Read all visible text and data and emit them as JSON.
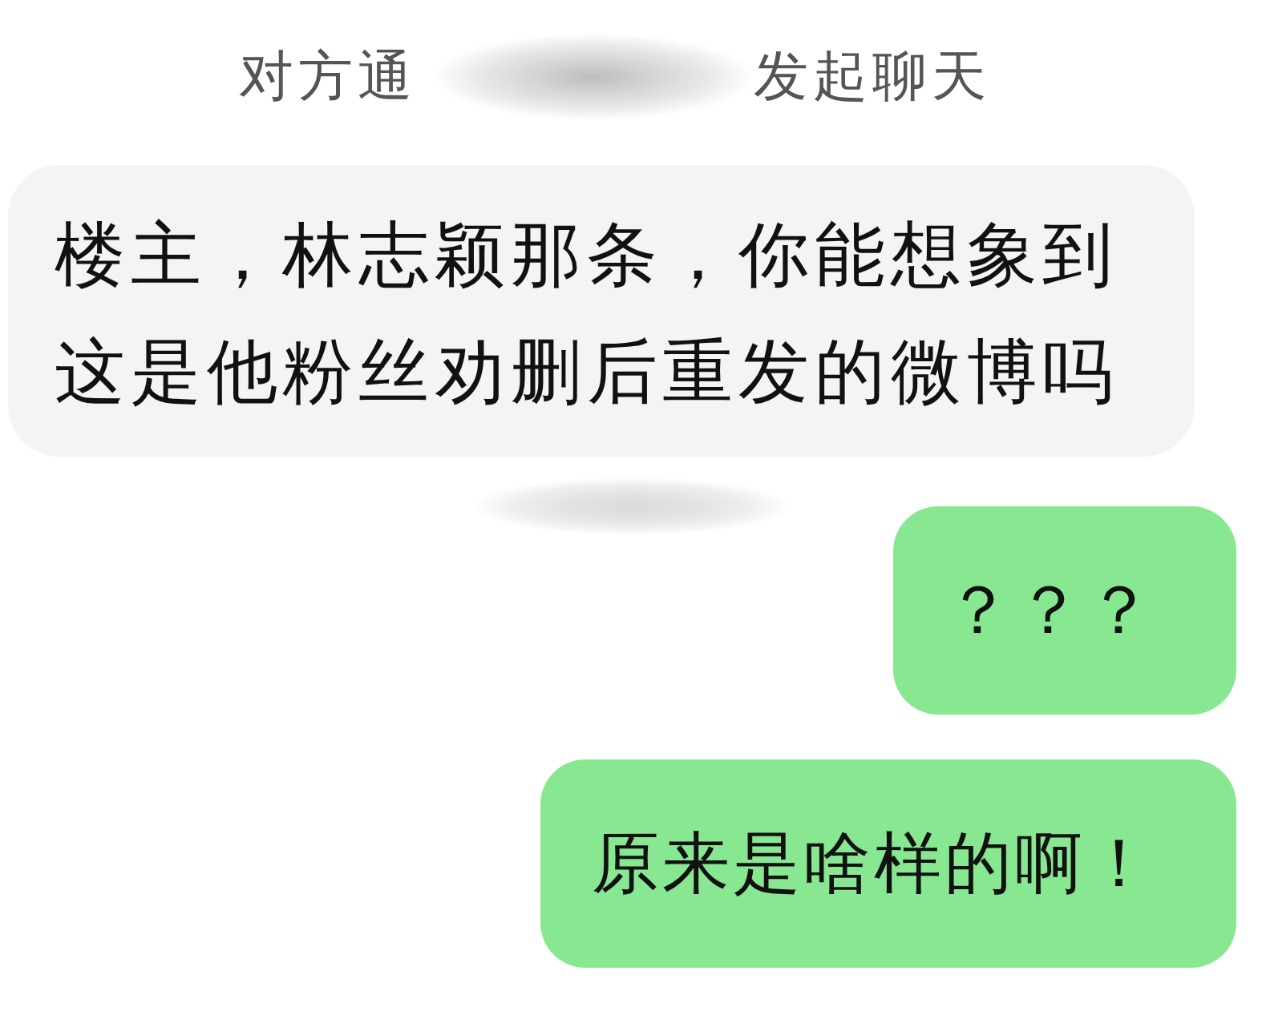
{
  "chat": {
    "notice": {
      "text_before": "对方通",
      "text_after": "发起聊天"
    },
    "messages": [
      {
        "kind": "incoming",
        "text": "楼主，林志颖那条，你能想象到这是他粉丝劝删后重发的微博吗"
      },
      {
        "kind": "time_redacted"
      },
      {
        "kind": "outgoing",
        "text": "？？？"
      },
      {
        "kind": "outgoing",
        "text": "原来是啥样的啊！"
      }
    ]
  }
}
